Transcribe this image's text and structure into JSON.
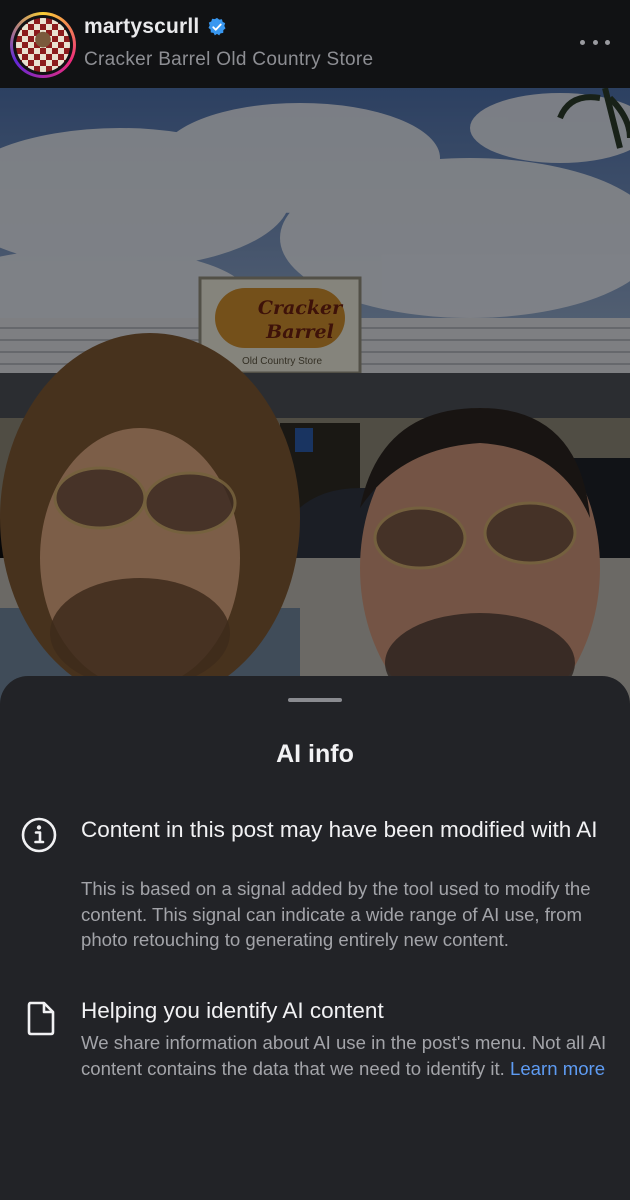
{
  "header": {
    "username": "martyscurll",
    "location": "Cracker Barrel Old Country Store",
    "verified_icon": "verified-badge-icon",
    "more_icon": "more-horizontal-icon"
  },
  "photo": {
    "storefront_sign": {
      "brand_line1": "Cracker",
      "brand_line2": "Barrel",
      "tagline": "Old Country Store"
    }
  },
  "sheet": {
    "title": "AI info",
    "rows": [
      {
        "icon": "info-circle-icon",
        "title": "Content in this post may have been modified with AI",
        "body": "This is based on a signal added by the tool used to modify the content. This signal can indicate a wide range of AI use, from photo retouching to generating entirely new content."
      },
      {
        "icon": "document-icon",
        "title": "Helping you identify AI content",
        "body": "We share information about AI use in the post's menu. Not all AI content contains the data that we need to identify it.",
        "link": "Learn more"
      }
    ]
  },
  "colors": {
    "sheet_bg": "#222327",
    "link": "#5e9bf2",
    "verified": "#3897f0"
  }
}
